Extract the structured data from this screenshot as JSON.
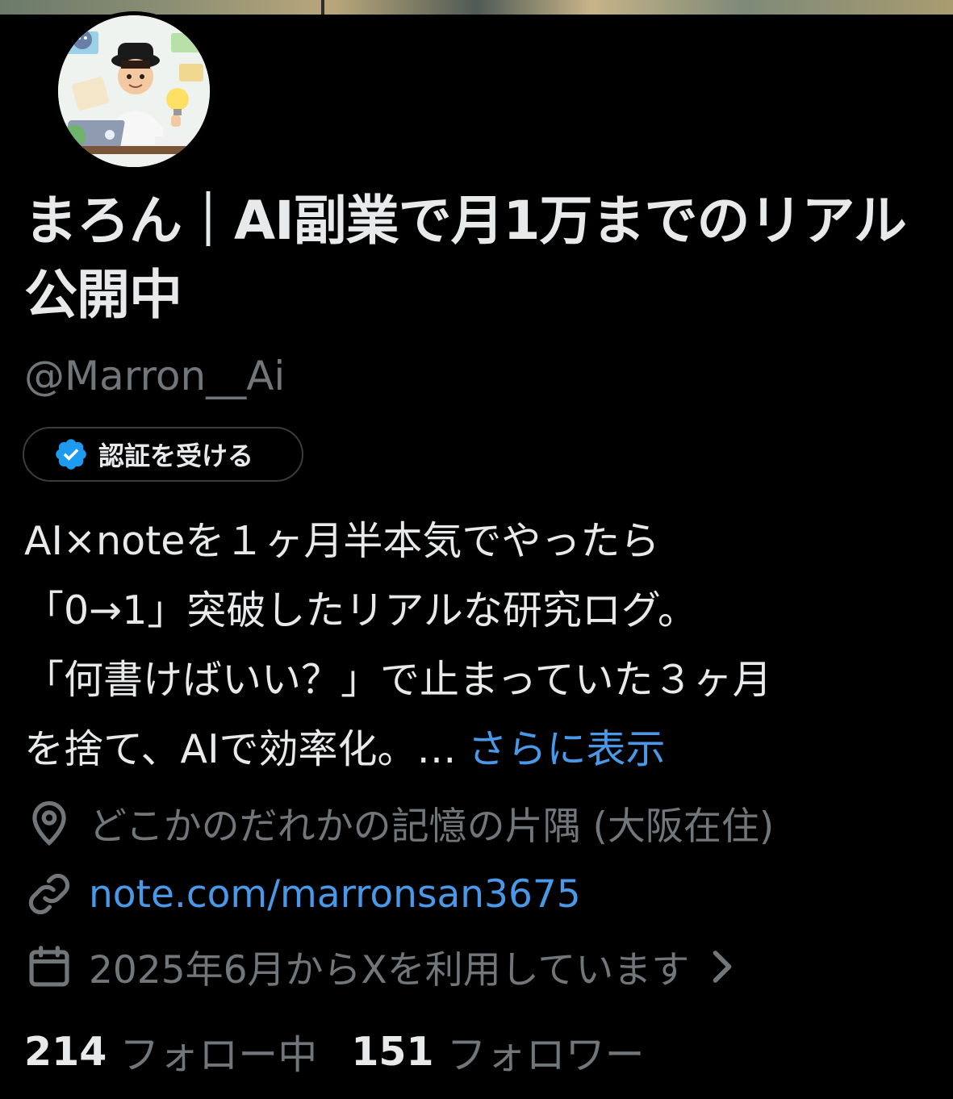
{
  "profile": {
    "display_name": "まろん｜AI副業で月1万までのリアル公開中",
    "handle": "@Marron__Ai",
    "verify_button": "認証を受ける",
    "bio_lines": [
      "AI×noteを１ヶ月半本気でやったら",
      "「0→1」突破したリアルな研究ログ。",
      "「何書けばいい？」で止まっていた３ヶ月",
      "を捨て、AIで効率化。…"
    ],
    "bio_more": "さらに表示",
    "location": "どこかのだれかの記憶の片隅 (大阪在住)",
    "website": "note.com/marronsan3675",
    "joined": "2025年6月からXを利用しています",
    "following_count": "214",
    "following_label": "フォロー中",
    "followers_count": "151",
    "followers_label": "フォロワー"
  },
  "icons": {
    "verify": "verified-badge-icon",
    "location": "location-pin-icon",
    "website": "link-icon",
    "joined": "calendar-icon",
    "chevron": "chevron-right-icon"
  },
  "colors": {
    "background": "#000000",
    "text_primary": "#e7e9ea",
    "text_secondary": "#71767b",
    "link": "#4a99e9",
    "verified": "#1d9bf0"
  }
}
